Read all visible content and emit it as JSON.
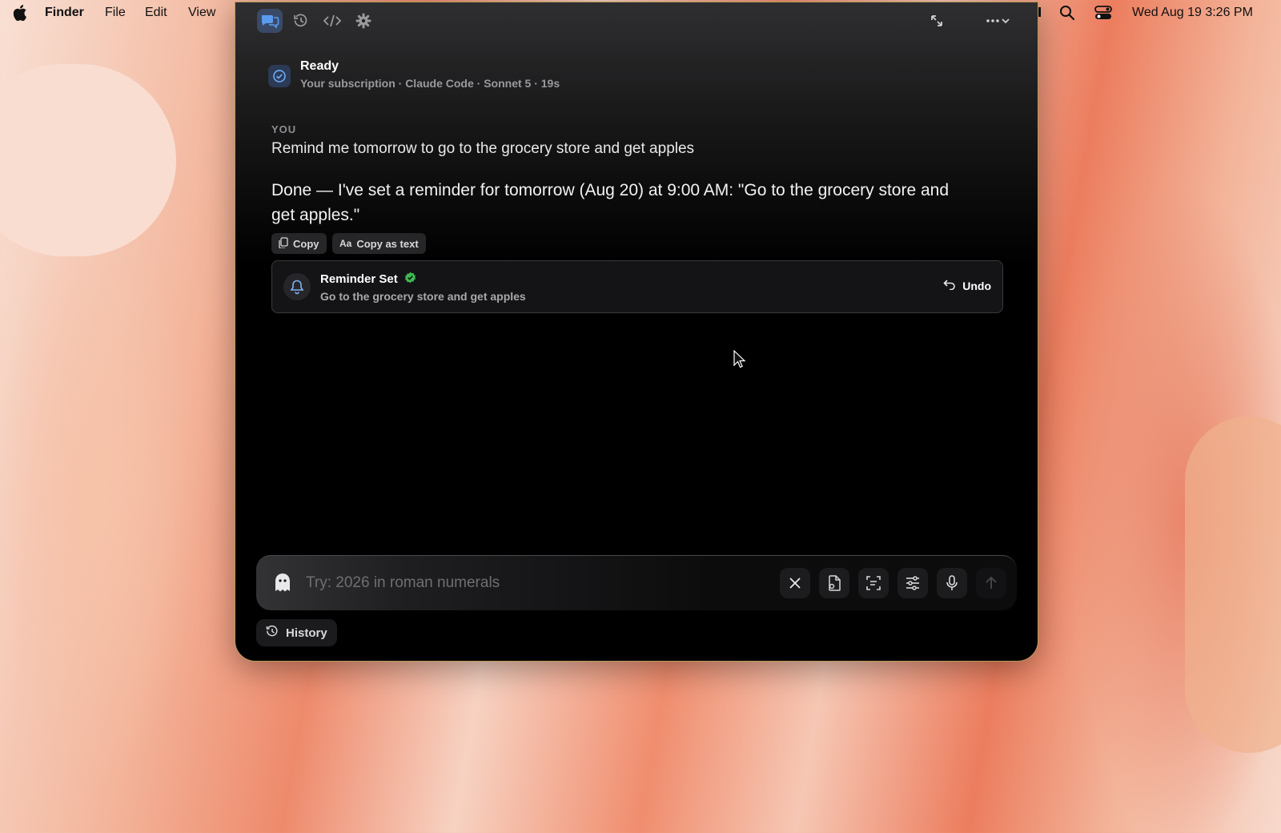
{
  "menubar": {
    "apple_icon": "apple-icon",
    "app_name": "Finder",
    "menus": [
      "File",
      "Edit",
      "View"
    ],
    "datetime": "Wed Aug 19  3:26 PM"
  },
  "toolbar": {
    "icons": [
      "chat-icon",
      "history-clock-icon",
      "code-icon",
      "gear-icon"
    ],
    "expand_icon": "expand-icon",
    "more_icon": "more-dots-icon"
  },
  "status": {
    "title": "Ready",
    "subtitle": "Your subscription · Claude Code · Sonnet 5 · 19s"
  },
  "conversation": {
    "user_label": "YOU",
    "user_message": "Remind me tomorrow to go to the grocery store and get apples",
    "assistant_reply": "Done — I've set a reminder for tomorrow (Aug 20) at 9:00 AM: \"Go to the grocery store and get apples.\"",
    "copy_label": "Copy",
    "copy_as_text_label": "Copy as text",
    "copy_as_text_prefix": "Aa"
  },
  "reminder_card": {
    "title": "Reminder Set",
    "description": "Go to the grocery store and get apples",
    "undo_label": "Undo",
    "status_color": "#3fb950"
  },
  "input": {
    "placeholder": "Try: 2026 in roman numerals",
    "value": ""
  },
  "footer": {
    "history_label": "History"
  },
  "colors": {
    "accent": "#4a90e2",
    "badge_bg": "#2b3a55"
  }
}
